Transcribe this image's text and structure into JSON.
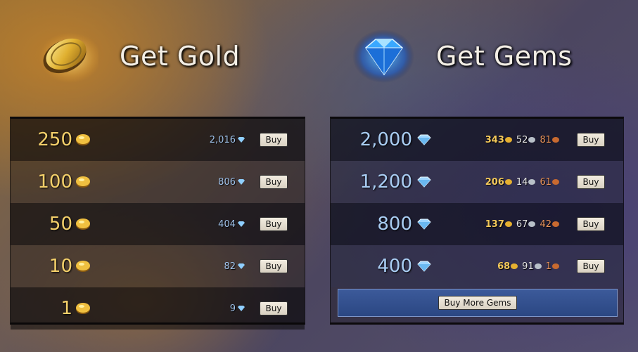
{
  "gold_section": {
    "title": "Get Gold",
    "rows": [
      {
        "amount": "250",
        "price": "2,016",
        "buy": "Buy"
      },
      {
        "amount": "100",
        "price": "806",
        "buy": "Buy"
      },
      {
        "amount": "50",
        "price": "404",
        "buy": "Buy"
      },
      {
        "amount": "10",
        "price": "82",
        "buy": "Buy"
      },
      {
        "amount": "1",
        "price": "9",
        "buy": "Buy"
      }
    ]
  },
  "gems_section": {
    "title": "Get Gems",
    "rows": [
      {
        "amount": "2,000",
        "gold": "343",
        "silver": "52",
        "copper": "81",
        "buy": "Buy"
      },
      {
        "amount": "1,200",
        "gold": "206",
        "silver": "14",
        "copper": "61",
        "buy": "Buy"
      },
      {
        "amount": "800",
        "gold": "137",
        "silver": "67",
        "copper": "42",
        "buy": "Buy"
      },
      {
        "amount": "400",
        "gold": "68",
        "silver": "91",
        "copper": "1",
        "buy": "Buy"
      }
    ],
    "more_button": "Buy More Gems"
  },
  "icons": {
    "gold": "gold-coin-icon",
    "gem": "gem-icon",
    "silver": "silver-coin-icon",
    "copper": "copper-coin-icon"
  },
  "colors": {
    "gold_text": "#f3cf6a",
    "gem_text": "#a9cdf3",
    "copper_text": "#e8935a",
    "more_bar": "#3c5a9a"
  }
}
